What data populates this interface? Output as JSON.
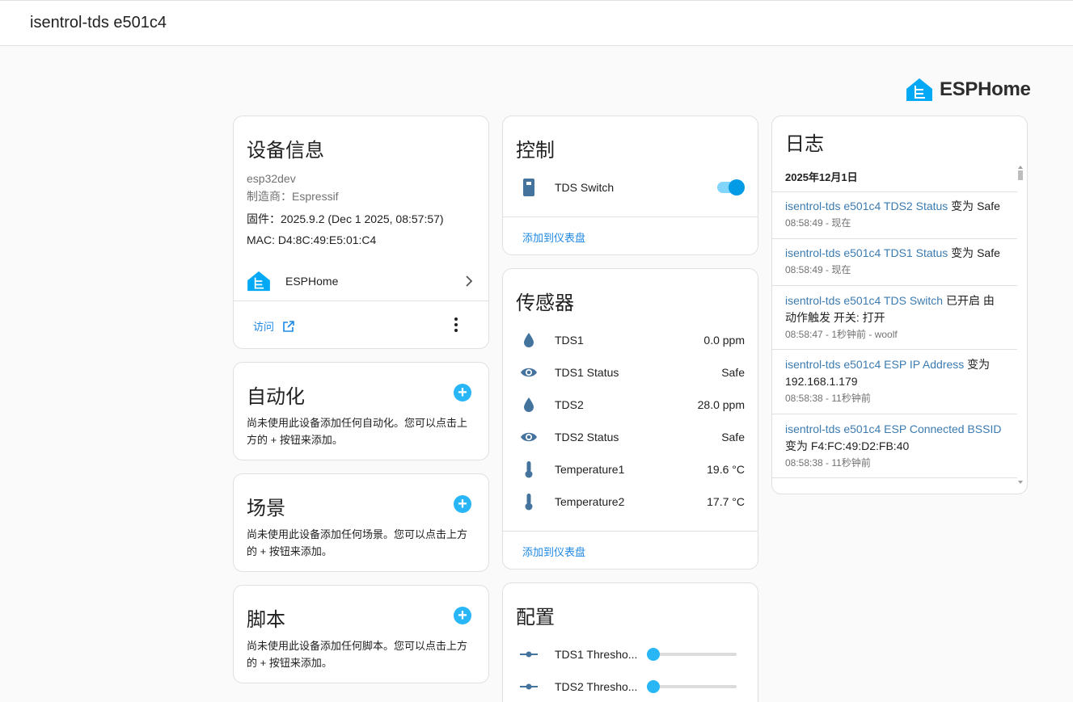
{
  "header": {
    "title": "isentrol-tds e501c4"
  },
  "brand": {
    "name": "ESPHome",
    "icon": "esphome-house-icon",
    "color": "#03a9f4"
  },
  "device_info": {
    "title": "设备信息",
    "model": "esp32dev",
    "manufacturer": "制造商：Espressif",
    "firmware": "固件：2025.9.2 (Dec 1 2025, 08:57:57)",
    "mac": "MAC: D4:8C:49:E5:01:C4",
    "integration": "ESPHome",
    "visit_label": "访问"
  },
  "automation": {
    "title": "自动化",
    "text": "尚未使用此设备添加任何自动化。您可以点击上方的 + 按钮来添加。"
  },
  "scene": {
    "title": "场景",
    "text": "尚未使用此设备添加任何场景。您可以点击上方的 + 按钮来添加。"
  },
  "script": {
    "title": "脚本",
    "text": "尚未使用此设备添加任何脚本。您可以点击上方的 + 按钮来添加。"
  },
  "controls": {
    "title": "控制",
    "items": [
      {
        "name": "TDS Switch",
        "icon": "switch-icon",
        "on": true
      }
    ],
    "add_label": "添加到仪表盘"
  },
  "sensors": {
    "title": "传感器",
    "items": [
      {
        "name": "TDS1",
        "value": "0.0 ppm",
        "icon": "water-drop-icon"
      },
      {
        "name": "TDS1 Status",
        "value": "Safe",
        "icon": "eye-icon"
      },
      {
        "name": "TDS2",
        "value": "28.0 ppm",
        "icon": "water-drop-icon"
      },
      {
        "name": "TDS2 Status",
        "value": "Safe",
        "icon": "eye-icon"
      },
      {
        "name": "Temperature1",
        "value": "19.6 °C",
        "icon": "thermometer-icon"
      },
      {
        "name": "Temperature2",
        "value": "17.7 °C",
        "icon": "thermometer-icon"
      }
    ],
    "add_label": "添加到仪表盘"
  },
  "config": {
    "title": "配置",
    "items": [
      {
        "name": "TDS1 Thresho...",
        "level": 0.02,
        "icon": "slider-icon"
      },
      {
        "name": "TDS2 Thresho...",
        "level": 0.02,
        "icon": "slider-icon"
      }
    ]
  },
  "logbook": {
    "title": "日志",
    "date": "2025年12月1日",
    "entries": [
      {
        "entity": "isentrol-tds e501c4 TDS2 Status",
        "message": " 变为 Safe",
        "time": "08:58:49 - 现在"
      },
      {
        "entity": "isentrol-tds e501c4 TDS1 Status",
        "message": " 变为 Safe",
        "time": "08:58:49 - 现在"
      },
      {
        "entity": "isentrol-tds e501c4 TDS Switch",
        "message": " 已开启 由动作触发 开关: 打开",
        "time": "08:58:47 - 1秒钟前 - woolf"
      },
      {
        "entity": "isentrol-tds e501c4 ESP IP Address",
        "message": " 变为 192.168.1.179",
        "time": "08:58:38 - 11秒钟前"
      },
      {
        "entity": "isentrol-tds e501c4 ESP Connected BSSID",
        "message": " 变为 F4:FC:49:D2:FB:40",
        "time": "08:58:38 - 11秒钟前"
      }
    ]
  }
}
